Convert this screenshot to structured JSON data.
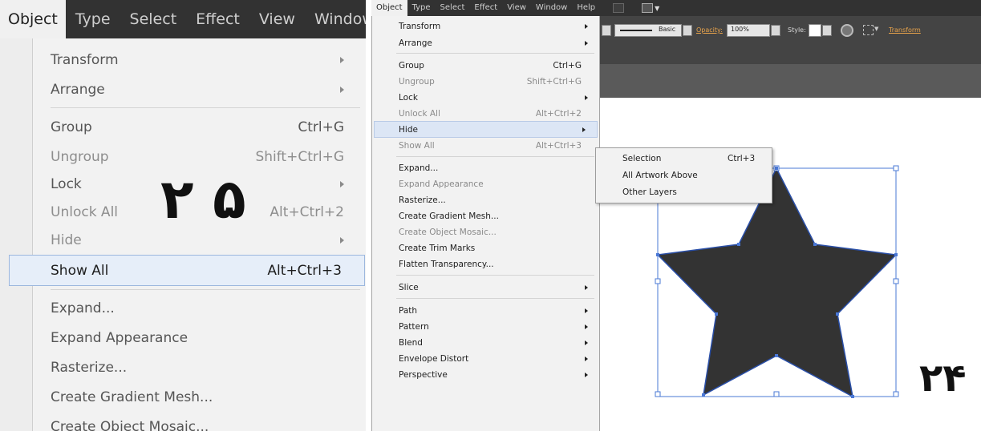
{
  "left_panel": {
    "menubar": [
      "Object",
      "Type",
      "Select",
      "Effect",
      "View",
      "Window"
    ],
    "menu_items": [
      {
        "label": "Transform",
        "shortcut": "",
        "submenu": true
      },
      {
        "label": "Arrange",
        "shortcut": "",
        "submenu": true
      },
      {
        "label": "Group",
        "shortcut": "Ctrl+G",
        "submenu": false
      },
      {
        "label": "Ungroup",
        "shortcut": "Shift+Ctrl+G",
        "submenu": false
      },
      {
        "label": "Lock",
        "shortcut": "",
        "submenu": true
      },
      {
        "label": "Unlock All",
        "shortcut": "Alt+Ctrl+2",
        "submenu": false
      },
      {
        "label": "Hide",
        "shortcut": "",
        "submenu": true
      },
      {
        "label": "Show All",
        "shortcut": "Alt+Ctrl+3",
        "submenu": false
      },
      {
        "label": "Expand...",
        "shortcut": "",
        "submenu": false
      },
      {
        "label": "Expand Appearance",
        "shortcut": "",
        "submenu": false
      },
      {
        "label": "Rasterize...",
        "shortcut": "",
        "submenu": false
      },
      {
        "label": "Create Gradient Mesh...",
        "shortcut": "",
        "submenu": false
      },
      {
        "label": "Create Object Mosaic...",
        "shortcut": "",
        "submenu": false
      }
    ],
    "annotation": "۲ ۵"
  },
  "right_panel": {
    "menubar": [
      "Object",
      "Type",
      "Select",
      "Effect",
      "View",
      "Window",
      "Help"
    ],
    "control_bar": {
      "stroke_style": "Basic",
      "opacity_label": "Opacity:",
      "opacity_value": "100%",
      "style_label": "Style:",
      "transform_link": "Transform"
    },
    "menu_items": [
      {
        "label": "Transform",
        "shortcut": "",
        "submenu": true
      },
      {
        "label": "Arrange",
        "shortcut": "",
        "submenu": true
      },
      {
        "label": "Group",
        "shortcut": "Ctrl+G",
        "submenu": false
      },
      {
        "label": "Ungroup",
        "shortcut": "Shift+Ctrl+G",
        "submenu": false
      },
      {
        "label": "Lock",
        "shortcut": "",
        "submenu": true
      },
      {
        "label": "Unlock All",
        "shortcut": "Alt+Ctrl+2",
        "submenu": false
      },
      {
        "label": "Hide",
        "shortcut": "",
        "submenu": true
      },
      {
        "label": "Show All",
        "shortcut": "Alt+Ctrl+3",
        "submenu": false
      },
      {
        "label": "Expand...",
        "shortcut": "",
        "submenu": false
      },
      {
        "label": "Expand Appearance",
        "shortcut": "",
        "submenu": false
      },
      {
        "label": "Rasterize...",
        "shortcut": "",
        "submenu": false
      },
      {
        "label": "Create Gradient Mesh...",
        "shortcut": "",
        "submenu": false
      },
      {
        "label": "Create Object Mosaic...",
        "shortcut": "",
        "submenu": false
      },
      {
        "label": "Create Trim Marks",
        "shortcut": "",
        "submenu": false
      },
      {
        "label": "Flatten Transparency...",
        "shortcut": "",
        "submenu": false
      },
      {
        "label": "Slice",
        "shortcut": "",
        "submenu": true
      },
      {
        "label": "Path",
        "shortcut": "",
        "submenu": true
      },
      {
        "label": "Pattern",
        "shortcut": "",
        "submenu": true
      },
      {
        "label": "Blend",
        "shortcut": "",
        "submenu": true
      },
      {
        "label": "Envelope Distort",
        "shortcut": "",
        "submenu": true
      },
      {
        "label": "Perspective",
        "shortcut": "",
        "submenu": true
      }
    ],
    "hide_submenu": [
      {
        "label": "Selection",
        "shortcut": "Ctrl+3"
      },
      {
        "label": "All Artwork Above",
        "shortcut": ""
      },
      {
        "label": "Other Layers",
        "shortcut": ""
      }
    ],
    "annotation": "۲۴"
  },
  "colors": {
    "menubar_bg": "#323232",
    "menu_bg": "#f2f2f2",
    "highlight_bg": "#dce6f5",
    "highlight_border": "#9cb7de",
    "star_fill": "#333333",
    "selection_blue": "#4a78d6",
    "link_orange": "#e8a34b"
  }
}
